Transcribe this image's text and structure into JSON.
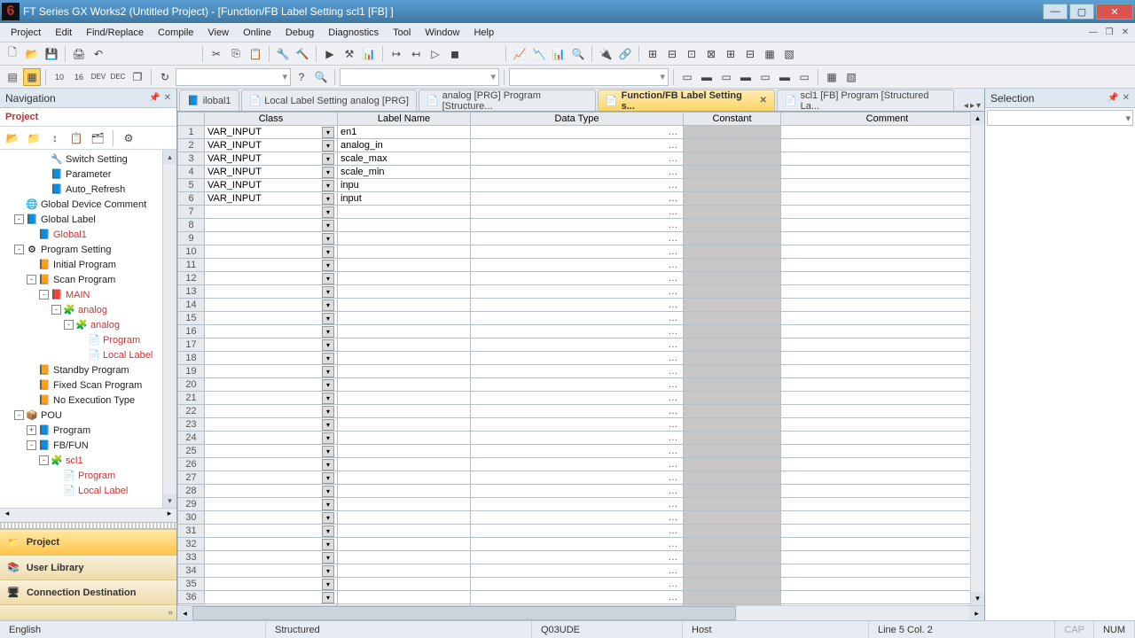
{
  "title": "FT Series GX Works2 (Untitled Project) - [Function/FB Label Setting scl1 [FB] ]",
  "menu": [
    "Project",
    "Edit",
    "Find/Replace",
    "Compile",
    "View",
    "Online",
    "Debug",
    "Diagnostics",
    "Tool",
    "Window",
    "Help"
  ],
  "nav": {
    "header": "Navigation",
    "project_label": "Project",
    "items": [
      {
        "ind": 3,
        "exp": "",
        "icon": "🔧",
        "label": "Switch Setting"
      },
      {
        "ind": 3,
        "exp": "",
        "icon": "📘",
        "label": "Parameter"
      },
      {
        "ind": 3,
        "exp": "",
        "icon": "📘",
        "label": "Auto_Refresh"
      },
      {
        "ind": 1,
        "exp": "",
        "icon": "🌐",
        "label": "Global Device Comment"
      },
      {
        "ind": 1,
        "exp": "-",
        "icon": "📘",
        "label": "Global Label"
      },
      {
        "ind": 2,
        "exp": "",
        "icon": "📘",
        "label": "Global1",
        "red": true
      },
      {
        "ind": 1,
        "exp": "-",
        "icon": "⚙",
        "label": "Program Setting"
      },
      {
        "ind": 2,
        "exp": "",
        "icon": "📙",
        "label": "Initial Program"
      },
      {
        "ind": 2,
        "exp": "-",
        "icon": "📙",
        "label": "Scan Program"
      },
      {
        "ind": 3,
        "exp": "-",
        "icon": "📕",
        "label": "MAIN",
        "red": true
      },
      {
        "ind": 4,
        "exp": "-",
        "icon": "🧩",
        "label": "analog",
        "red": true
      },
      {
        "ind": 5,
        "exp": "-",
        "icon": "🧩",
        "label": "analog",
        "red": true
      },
      {
        "ind": 6,
        "exp": "",
        "icon": "📄",
        "label": "Program",
        "red": true
      },
      {
        "ind": 6,
        "exp": "",
        "icon": "📄",
        "label": "Local Label",
        "red": true
      },
      {
        "ind": 2,
        "exp": "",
        "icon": "📙",
        "label": "Standby Program"
      },
      {
        "ind": 2,
        "exp": "",
        "icon": "📙",
        "label": "Fixed Scan Program"
      },
      {
        "ind": 2,
        "exp": "",
        "icon": "📙",
        "label": "No Execution Type"
      },
      {
        "ind": 1,
        "exp": "-",
        "icon": "📦",
        "label": "POU"
      },
      {
        "ind": 2,
        "exp": "+",
        "icon": "📘",
        "label": "Program"
      },
      {
        "ind": 2,
        "exp": "-",
        "icon": "📘",
        "label": "FB/FUN"
      },
      {
        "ind": 3,
        "exp": "-",
        "icon": "🧩",
        "label": "scl1",
        "red": true
      },
      {
        "ind": 4,
        "exp": "",
        "icon": "📄",
        "label": "Program",
        "red": true
      },
      {
        "ind": 4,
        "exp": "",
        "icon": "📄",
        "label": "Local Label",
        "red": true
      }
    ],
    "buttons": [
      "Project",
      "User Library",
      "Connection Destination"
    ]
  },
  "tabs": [
    {
      "label": "ilobal1",
      "active": false,
      "icon": "📘"
    },
    {
      "label": "Local Label Setting analog [PRG]",
      "active": false,
      "icon": "📄"
    },
    {
      "label": "analog [PRG] Program [Structure...",
      "active": false,
      "icon": "📄"
    },
    {
      "label": "Function/FB Label Setting s...",
      "active": true,
      "icon": "📄",
      "close": true
    },
    {
      "label": "scl1 [FB] Program [Structured La...",
      "active": false,
      "icon": "📄"
    }
  ],
  "grid": {
    "headers": [
      "Class",
      "Label Name",
      "Data Type",
      "Constant",
      "Comment"
    ],
    "rows": [
      {
        "n": 1,
        "class": "VAR_INPUT",
        "label": "en1"
      },
      {
        "n": 2,
        "class": "VAR_INPUT",
        "label": "analog_in"
      },
      {
        "n": 3,
        "class": "VAR_INPUT",
        "label": "scale_max"
      },
      {
        "n": 4,
        "class": "VAR_INPUT",
        "label": "scale_min"
      },
      {
        "n": 5,
        "class": "VAR_INPUT",
        "label": "inpu"
      },
      {
        "n": 6,
        "class": "VAR_INPUT",
        "label": "input"
      }
    ],
    "total_rows": 37
  },
  "selection": {
    "header": "Selection"
  },
  "status": {
    "lang": "English",
    "mode": "Structured",
    "plc": "Q03UDE",
    "conn": "Host",
    "pos": "Line 5 Col. 2",
    "cap": "CAP",
    "num": "NUM"
  }
}
